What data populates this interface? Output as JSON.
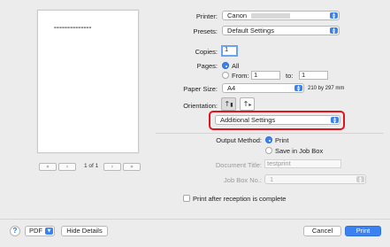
{
  "preview": {
    "page_text": "▬▬▬▬▬▬▬▬▬▬▬▬▬▬",
    "first_icon": "«",
    "prev_icon": "‹",
    "next_icon": "›",
    "last_icon": "»",
    "page_counter": "1 of 1"
  },
  "printer": {
    "label": "Printer:",
    "value": "Canon"
  },
  "presets": {
    "label": "Presets:",
    "value": "Default Settings"
  },
  "copies": {
    "label": "Copies:",
    "value": "1"
  },
  "pages": {
    "label": "Pages:",
    "all_label": "All",
    "from_label": "From:",
    "from_value": "1",
    "to_label": "to:",
    "to_value": "1"
  },
  "paper_size": {
    "label": "Paper Size:",
    "value": "A4",
    "dimensions": "210 by 297 mm"
  },
  "orientation": {
    "label": "Orientation:",
    "portrait_icon": "portrait-icon",
    "landscape_icon": "landscape-icon"
  },
  "section_popup": {
    "value": "Additional Settings"
  },
  "output_method": {
    "label": "Output Method:",
    "print_label": "Print",
    "save_label": "Save in Job Box"
  },
  "document_title": {
    "label": "Document Title:",
    "value": "testprint"
  },
  "job_box": {
    "label": "Job Box No.:",
    "value": "1"
  },
  "print_after_reception": {
    "label": "Print after reception is complete"
  },
  "footer": {
    "help": "?",
    "pdf_label": "PDF",
    "hide_details_label": "Hide Details",
    "cancel_label": "Cancel",
    "print_label": "Print"
  },
  "colors": {
    "accent": "#3b82f0",
    "highlight": "#e0141e"
  }
}
